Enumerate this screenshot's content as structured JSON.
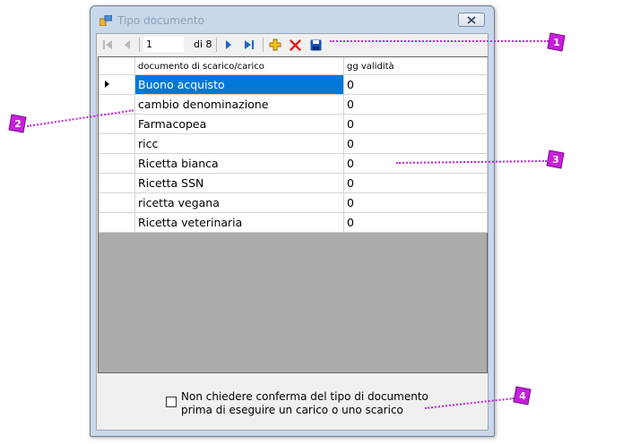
{
  "window": {
    "title": "Tipo documento"
  },
  "navigator": {
    "position": "1",
    "count": "di 8"
  },
  "grid": {
    "columns": [
      "documento di scarico/carico",
      "gg validità"
    ],
    "rows": [
      {
        "name": "Buono acquisto",
        "days": "0"
      },
      {
        "name": "cambio denominazione",
        "days": "0"
      },
      {
        "name": "Farmacopea",
        "days": "0"
      },
      {
        "name": "ricc",
        "days": "0"
      },
      {
        "name": "Ricetta bianca",
        "days": "0"
      },
      {
        "name": "Ricetta SSN",
        "days": "0"
      },
      {
        "name": "ricetta vegana",
        "days": "0"
      },
      {
        "name": "Ricetta veterinaria",
        "days": "0"
      }
    ]
  },
  "option": {
    "label": "Non chiedere conferma del tipo di documento prima di eseguire un carico o uno scarico",
    "checked": false
  },
  "callouts": [
    "1",
    "2",
    "3",
    "4"
  ],
  "colors": {
    "accent": "#c81edc",
    "selection": "#0078d7"
  }
}
